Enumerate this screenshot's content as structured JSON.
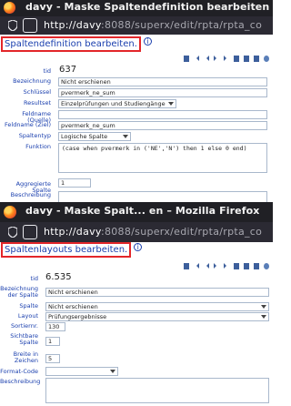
{
  "win1": {
    "title": "davy - Maske Spaltendefinition bearbeiten – Mozilla Firefox",
    "url_host": "http://davy",
    "url_rest": ":8088/superx/edit/rpta/rpta_co",
    "heading": "Spaltendefinition bearbeiten.",
    "fields": {
      "tid_label": "tid",
      "tid_value": "637",
      "bezeichnung_label": "Bezeichnung",
      "bezeichnung_value": "Nicht erschienen",
      "schluessel_label": "Schlüssel",
      "schluessel_value": "pvermerk_ne_sum",
      "resultset_label": "Resultset",
      "resultset_value": "Einzelprüfungen und Studiengänge",
      "feldname_quelle_label": "Feldname (Quelle)",
      "feldname_quelle_value": "",
      "feldname_ziel_label": "Feldname (Ziel)",
      "feldname_ziel_value": "pvermerk_ne_sum",
      "spaltentyp_label": "Spaltentyp",
      "spaltentyp_value": "Logische Spalte",
      "funktion_label": "Funktion",
      "funktion_value": "(case when pvermerk in ('NE','N') then 1 else 0 end)",
      "aggregierte_label": "Aggregierte Spalte",
      "aggregierte_value": "1",
      "beschreibung_label": "Beschreibung",
      "beschreibung_value": ""
    }
  },
  "win2": {
    "title": "davy - Maske Spalt... en – Mozilla Firefox",
    "url_host": "http://davy",
    "url_rest": ":8088/superx/edit/rpta/rpta_co",
    "heading": "Spaltenlayouts bearbeiten.",
    "fields": {
      "tid_label": "tid",
      "tid_value": "6.535",
      "bezeichnung_label": "Bezeichnung der Spalte",
      "bezeichnung_value": "Nicht erschienen",
      "spalte_label": "Spalte",
      "spalte_value": "Nicht erschienen",
      "layout_label": "Layout",
      "layout_value": "Prüfungsergebnisse",
      "sortiernr_label": "Sortiernr.",
      "sortiernr_value": "130",
      "sichtbare_label": "Sichtbare Spalte",
      "sichtbare_value": "1",
      "breite_label": "Breite in Zeichen",
      "breite_value": "5",
      "format_label": "Format-Code",
      "format_value": "",
      "beschreibung_label": "Beschreibung",
      "beschreibung_value": ""
    }
  }
}
